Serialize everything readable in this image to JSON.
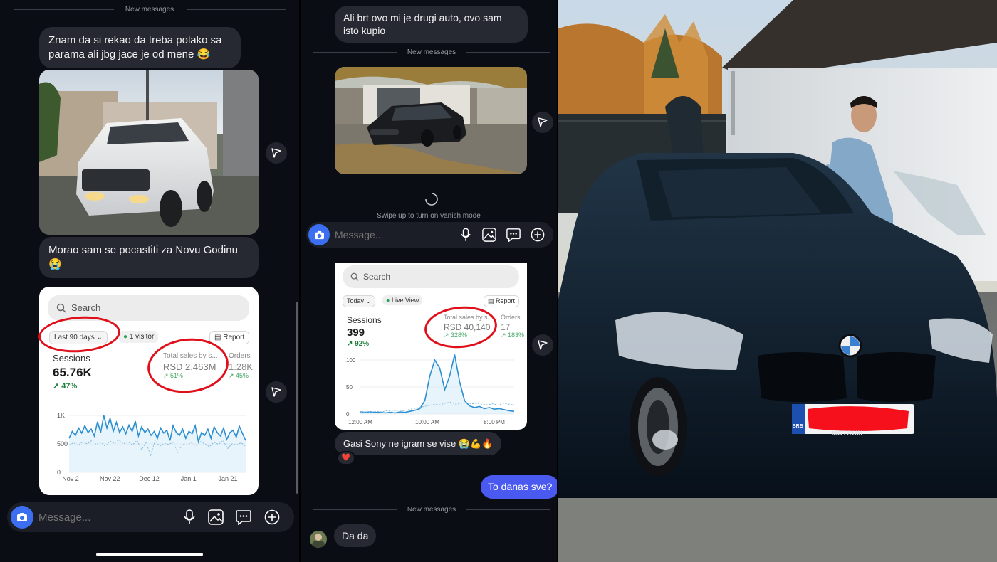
{
  "panel_left": {
    "separator": "New messages",
    "msg1": "Znam da si rekao da treba polako sa parama ali jbg jace je od mene 😂",
    "msg2": "Morao sam se pocastiti za Novu Godinu 😭",
    "analytics": {
      "search_placeholder": "Search",
      "range": "Last 90 days",
      "visitors": "1 visitor",
      "report": "Report",
      "sessions_label": "Sessions",
      "sessions_value": "65.76K",
      "sessions_change": "↗ 47%",
      "sales_label": "Total sales by s...",
      "sales_value": "RSD 2.463M",
      "sales_change": "↗ 51%",
      "orders_label": "Orders",
      "orders_value": "1.28K",
      "orders_change": "↗ 45%",
      "y_ticks": [
        "1K",
        "500",
        "0"
      ],
      "x_ticks": [
        "Nov 2",
        "Nov 22",
        "Dec 12",
        "Jan 1",
        "Jan 21"
      ]
    },
    "composer_placeholder": "Message..."
  },
  "panel_middle": {
    "msg_top": "Ali brt ovo mi je drugi auto, ovo sam isto kupio",
    "separator1": "New messages",
    "vanish_hint": "Swipe up to turn on vanish mode",
    "composer_placeholder": "Message...",
    "analytics": {
      "search_placeholder": "Search",
      "range": "Today",
      "live": "Live View",
      "report": "Report",
      "sessions_label": "Sessions",
      "sessions_value": "399",
      "sessions_change": "↗ 92%",
      "sales_label": "Total sales by s...",
      "sales_value": "RSD 40,140",
      "sales_change": "↗ 328%",
      "orders_label": "Orders",
      "orders_value": "17",
      "orders_change": "↗ 183%",
      "y_ticks": [
        "100",
        "50",
        "0"
      ],
      "x_ticks": [
        "12:00 AM",
        "10:00 AM",
        "8:00 PM"
      ]
    },
    "msg_sony": "Gasi Sony ne igram se vise 😭💪🔥",
    "reaction": "❤️",
    "msg_out": "To danas sve?",
    "separator2": "New messages",
    "msg_last": "Da da"
  },
  "panel_right": {
    "plate_country": "SRB",
    "plate_frame": "MOTRUM"
  },
  "chart_data": [
    {
      "type": "line",
      "title": "Sessions",
      "x_ticks": [
        "Nov 2",
        "Nov 22",
        "Dec 12",
        "Jan 1",
        "Jan 21"
      ],
      "ylim": [
        0,
        1000
      ],
      "series": [
        {
          "name": "Last 90 days",
          "values": [
            600,
            720,
            650,
            780,
            690,
            820,
            700,
            760,
            640,
            890,
            700,
            1000,
            780,
            950,
            720,
            880,
            700,
            800,
            680,
            830,
            720,
            900,
            640,
            800,
            700,
            760,
            650,
            720,
            600,
            780,
            690,
            740,
            560,
            820,
            700,
            650,
            760,
            600,
            720,
            680,
            820,
            540,
            700,
            650,
            760,
            600,
            800,
            700,
            640,
            780,
            580,
            700,
            740,
            620,
            810,
            680,
            560
          ]
        },
        {
          "values": [
            480,
            520,
            470,
            540,
            500,
            560,
            490,
            530,
            460,
            550,
            510,
            570,
            500,
            540,
            480,
            560,
            400,
            520,
            300,
            560,
            460,
            510,
            490,
            530,
            350,
            500,
            480,
            520,
            470,
            540,
            500,
            450,
            530,
            490,
            560,
            420,
            500,
            480,
            520,
            460
          ]
        }
      ]
    },
    {
      "type": "line",
      "title": "Sessions",
      "x_ticks": [
        "12:00 AM",
        "10:00 AM",
        "8:00 PM"
      ],
      "ylim": [
        0,
        100
      ],
      "series": [
        {
          "name": "Today",
          "values": [
            4,
            3,
            4,
            3,
            3,
            2,
            3,
            2,
            4,
            3,
            5,
            7,
            10,
            25,
            70,
            100,
            85,
            45,
            70,
            110,
            60,
            25,
            15,
            12,
            14,
            10,
            12,
            9,
            10,
            8,
            6,
            5
          ]
        },
        {
          "values": [
            3,
            4,
            3,
            5,
            4,
            6,
            5,
            7,
            6,
            8,
            10,
            12,
            14,
            16,
            18,
            17,
            20,
            22,
            18,
            20,
            21,
            19,
            20,
            18,
            17,
            19,
            16,
            20,
            18,
            17
          ]
        }
      ]
    }
  ]
}
